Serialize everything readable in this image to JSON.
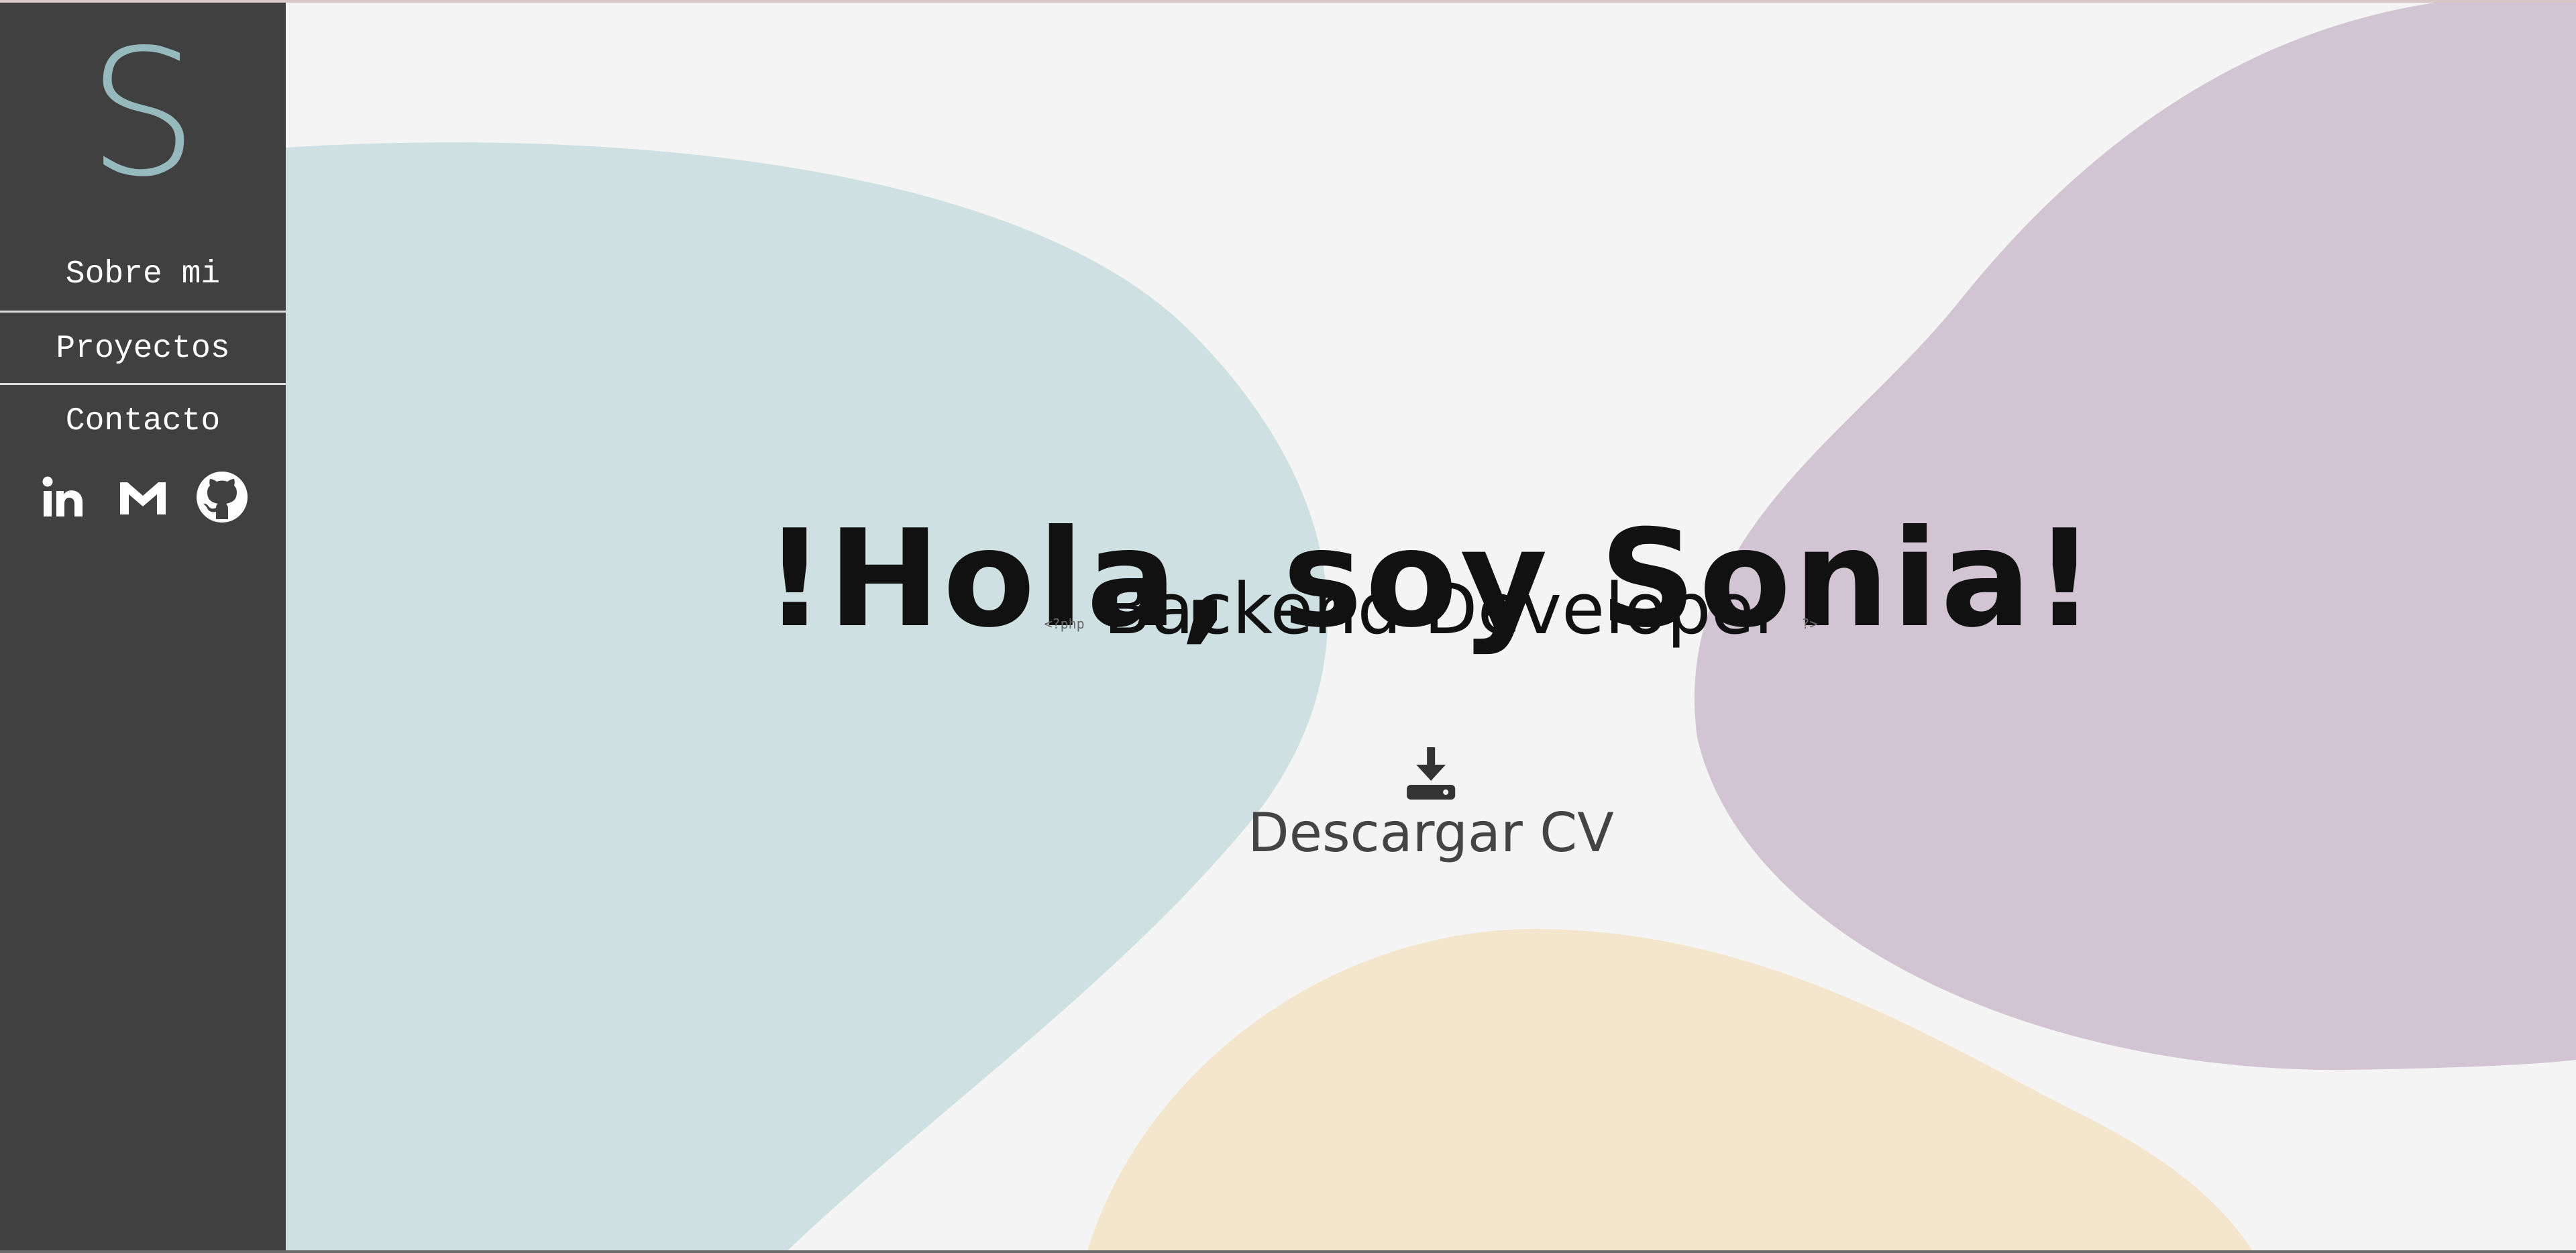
{
  "sidebar": {
    "logo": "S",
    "nav": [
      {
        "label": "Sobre mi"
      },
      {
        "label": "Proyectos"
      },
      {
        "label": "Contacto"
      }
    ],
    "socials": [
      {
        "icon": "linkedin-icon"
      },
      {
        "icon": "gmail-icon"
      },
      {
        "icon": "github-icon"
      }
    ]
  },
  "hero": {
    "title": "!Hola, soy Sonia!",
    "php_open": "<?php",
    "subtitle": "Backend Developer",
    "php_close": "?>",
    "download_label": "Descargar CV",
    "download_icon": "download-icon"
  },
  "colors": {
    "sidebar_bg": "#404040",
    "page_bg": "#f4f4f4",
    "logo": "#95b9bd",
    "blob_teal": "#cfe0e2",
    "blob_purple": "#d3c4d3",
    "blob_peach": "#f4e6cc"
  }
}
